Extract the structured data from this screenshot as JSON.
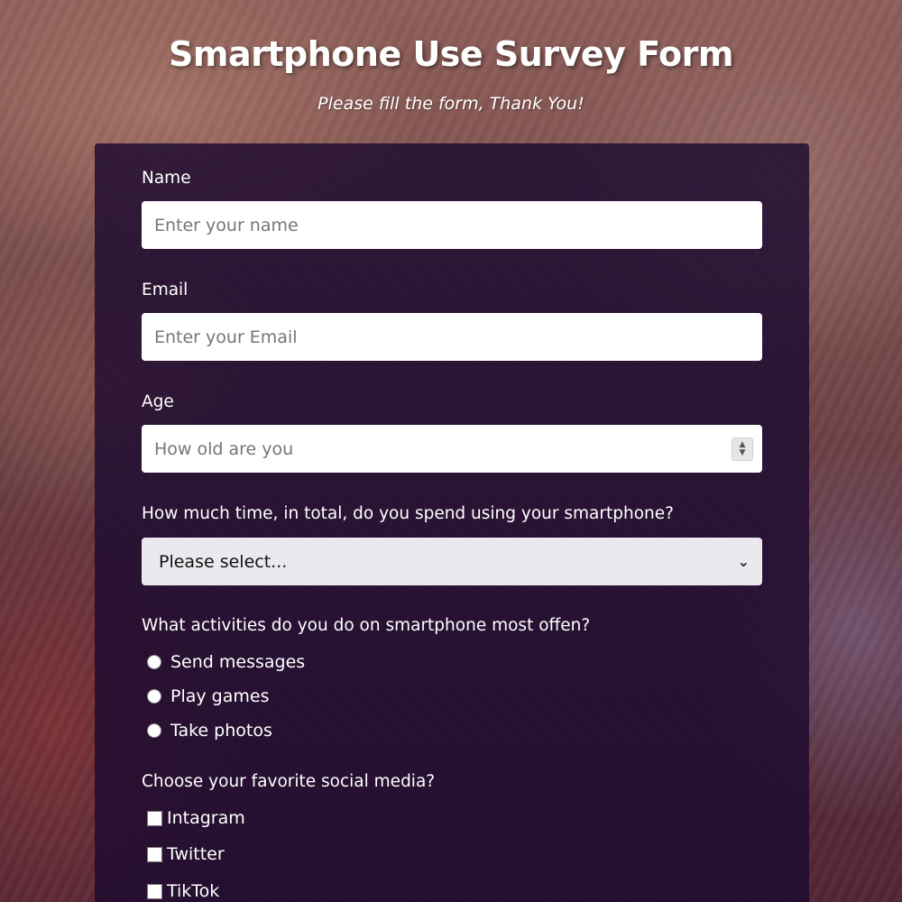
{
  "header": {
    "title": "Smartphone Use Survey Form",
    "subtitle": "Please fill the form, Thank You!"
  },
  "form": {
    "name": {
      "label": "Name",
      "placeholder": "Enter your name"
    },
    "email": {
      "label": "Email",
      "placeholder": "Enter your Email"
    },
    "age": {
      "label": "Age",
      "placeholder": "How old are you"
    },
    "time_spent": {
      "label": "How much time, in total, do you spend using your smartphone?",
      "selected": "Please select..."
    },
    "activities": {
      "label": "What activities do you do on smartphone most offen?",
      "options": [
        "Send messages",
        "Play games",
        "Take photos"
      ]
    },
    "social_media": {
      "label": "Choose your favorite social media?",
      "options": [
        "Intagram",
        "Twitter",
        "TikTok"
      ]
    }
  },
  "colors": {
    "card_background": "#1c0a30",
    "input_background": "#ffffff",
    "select_background": "#ebe9ee",
    "text": "#ffffff"
  },
  "icons": {
    "select_arrow": "chevron-down-icon",
    "number_spinner": "spinner-icon"
  }
}
